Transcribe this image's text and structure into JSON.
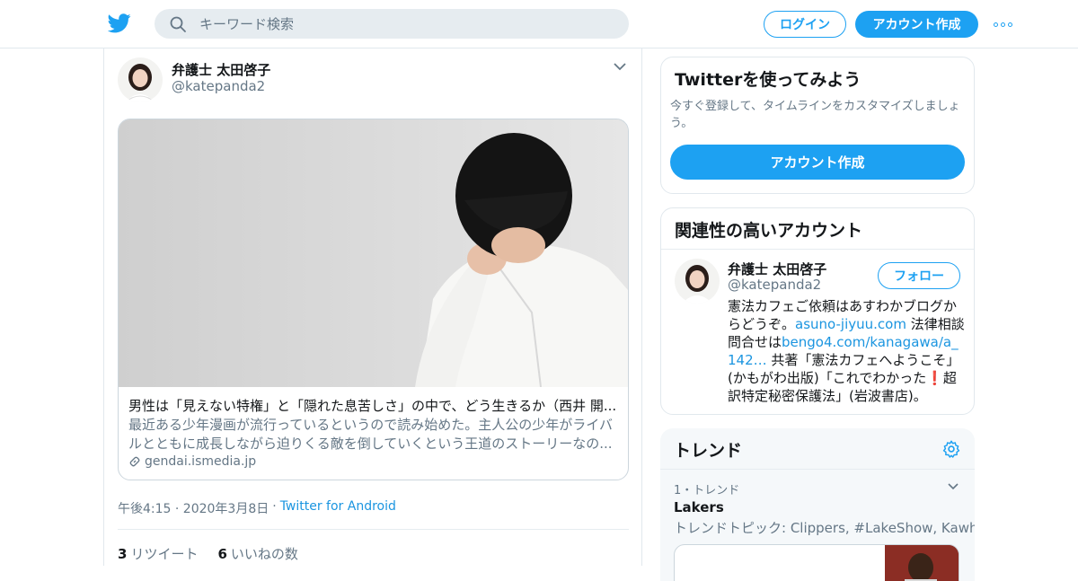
{
  "header": {
    "search_placeholder": "キーワード検索",
    "login_label": "ログイン",
    "signup_label": "アカウント作成"
  },
  "tweet": {
    "author_name": "弁護士 太田啓子",
    "author_handle": "@katepanda2",
    "card": {
      "title": "男性は「見えない特権」と「隠れた息苦しさ」の中で、どう生きるか（西井 開...",
      "description": "最近ある少年漫画が流行っているというので読み始めた。主人公の少年がライバルとともに成長しながら迫りくる敵を倒していくという王道のストーリーなの...",
      "domain": "gendai.ismedia.jp"
    },
    "time": "午後4:15 · 2020年3月8日",
    "sep": "·",
    "source": "Twitter for Android",
    "retweet_count": "3",
    "retweet_label": "リツイート",
    "like_count": "6",
    "like_label": "いいねの数"
  },
  "sidebar": {
    "signup_panel": {
      "title": "Twitterを使ってみよう",
      "description": "今すぐ登録して、タイムラインをカスタマイズしましょう。",
      "button_label": "アカウント作成"
    },
    "related": {
      "title": "関連性の高いアカウント",
      "name": "弁護士 太田啓子",
      "handle": "@katepanda2",
      "follow_label": "フォロー",
      "bio_1": "憲法カフェご依頼はあすわかブログからどうぞ。",
      "bio_link_1": "asuno-jiyuu.com",
      "bio_2": " 法律相談問合せは",
      "bio_link_2": "bengo4.com/kanagawa/a_142…",
      "bio_3": " 共著「憲法カフェへようこそ」(かもがわ出版)「これでわかった❗️超訳特定秘密保護法」(岩波書店)。"
    },
    "trends": {
      "title": "トレンド",
      "rank_label": "1・トレンド",
      "name": "Lakers",
      "topic": "トレンドトピック: Clippers, #LakeShow, Kawhi"
    }
  },
  "colors": {
    "accent": "#1da1f2",
    "link": "#1b95e0",
    "secondary_text": "#657786",
    "border": "#e1e8ed"
  }
}
